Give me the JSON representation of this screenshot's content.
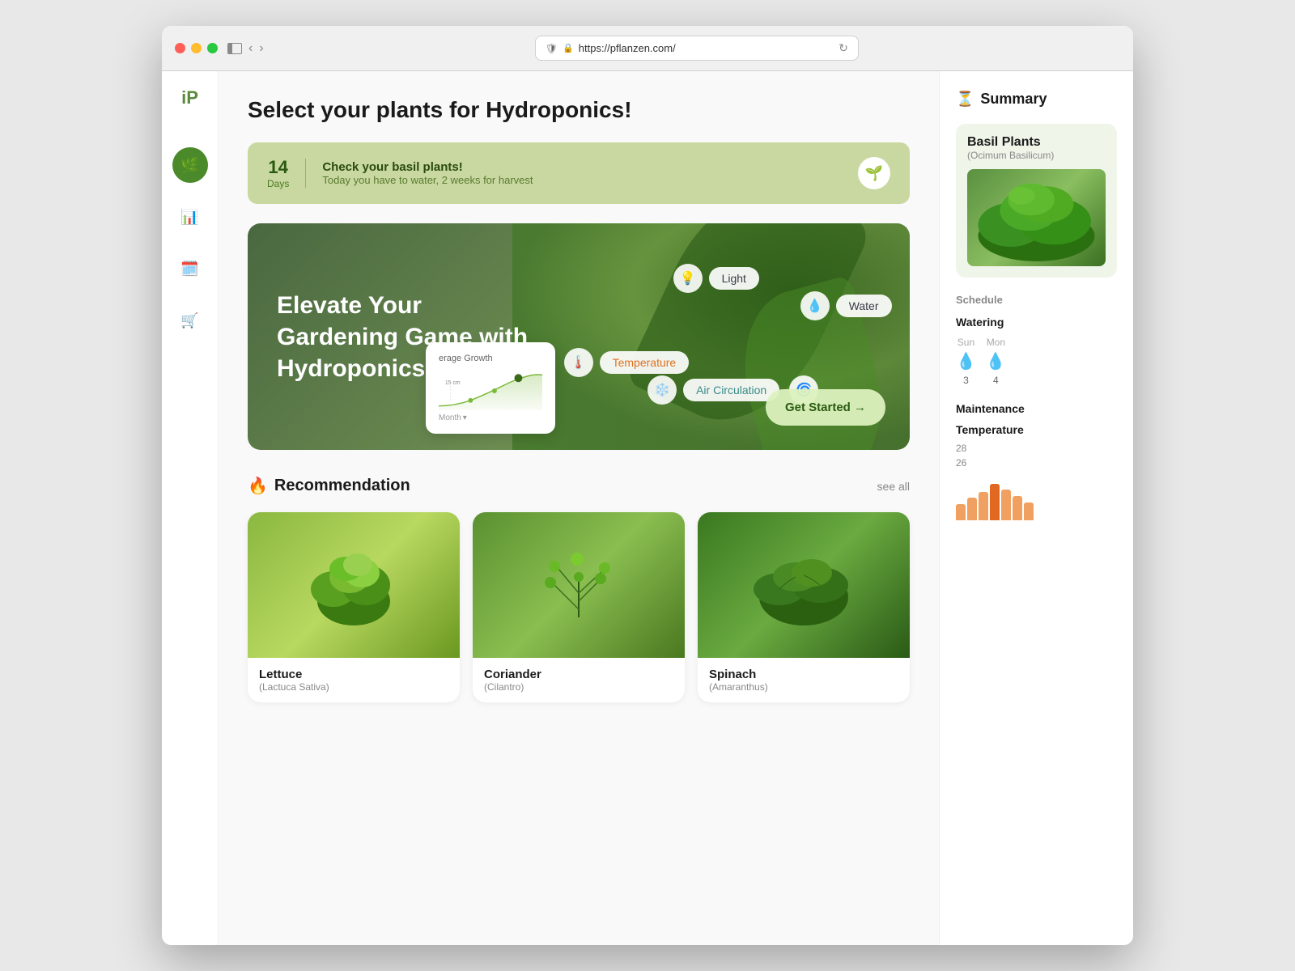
{
  "browser": {
    "url": "https://pflanzen.com/",
    "back_arrow": "‹",
    "forward_arrow": "›"
  },
  "page": {
    "title": "Select your plants for Hydroponics!"
  },
  "notification": {
    "days_number": "14",
    "days_label": "Days",
    "heading": "Check your basil plants!",
    "subtext": "Today you have to water, 2 weeks for harvest",
    "icon": "🌱"
  },
  "hero": {
    "title": "Elevate Your Gardening Game with Hydroponics",
    "chart_label": "erage Growth",
    "chart_month": "Month",
    "feature_temperature": "Temperature",
    "feature_light": "Light",
    "feature_water": "Water",
    "feature_air": "Air Circulation",
    "cta_button": "Get Started →"
  },
  "recommendation": {
    "section_title": "Recommendation",
    "fire_icon": "🔥",
    "see_all": "see all",
    "plants": [
      {
        "name": "Lettuce",
        "scientific": "(Lactuca Sativa)",
        "color": "lettuce"
      },
      {
        "name": "Coriander",
        "scientific": "(Cilantro)",
        "color": "coriander"
      },
      {
        "name": "Spinach",
        "scientific": "(Amaranthus)",
        "color": "spinach"
      }
    ]
  },
  "sidebar": {
    "logo": "iP",
    "nav_items": [
      {
        "id": "plants",
        "icon": "🌿",
        "active": true
      },
      {
        "id": "analytics",
        "icon": "📊",
        "active": false
      },
      {
        "id": "calendar",
        "icon": "🗓️",
        "active": false
      },
      {
        "id": "cart",
        "icon": "🛒",
        "active": false
      }
    ]
  },
  "summary_panel": {
    "title": "Summary",
    "hourglass": "⏳",
    "plant_name": "Basil Plants",
    "plant_scientific": "(Ocimum Basilicum)",
    "schedule_label": "Schedule",
    "watering_label": "Watering",
    "watering_days": [
      {
        "day": "Sun",
        "num": "3"
      },
      {
        "day": "Mon",
        "num": "4"
      }
    ],
    "maintenance_label": "Maintenance",
    "temperature_label": "Temperature",
    "temp_values": [
      "28",
      "26"
    ]
  }
}
